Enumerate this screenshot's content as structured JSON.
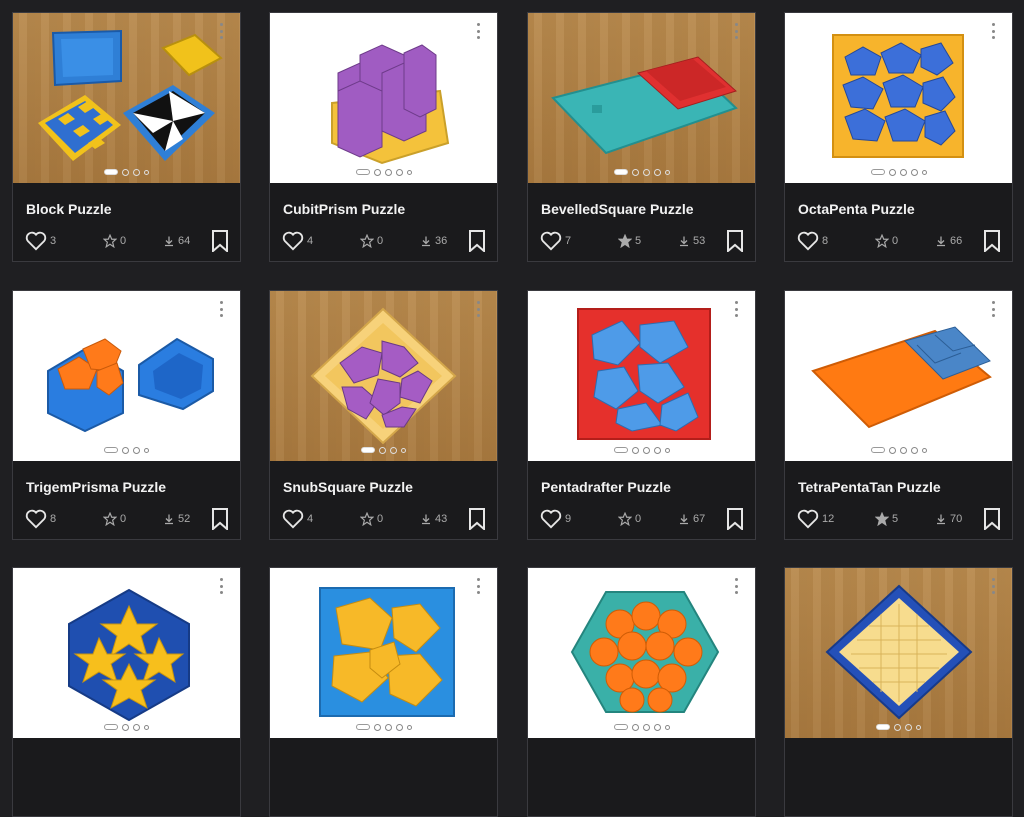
{
  "cards": [
    {
      "title": "Block Puzzle",
      "likes": "3",
      "stars": "0",
      "downloads": "64",
      "starred": false
    },
    {
      "title": "CubitPrism Puzzle",
      "likes": "4",
      "stars": "0",
      "downloads": "36",
      "starred": false
    },
    {
      "title": "BevelledSquare Puzzle",
      "likes": "7",
      "stars": "5",
      "downloads": "53",
      "starred": true
    },
    {
      "title": "OctaPenta Puzzle",
      "likes": "8",
      "stars": "0",
      "downloads": "66",
      "starred": false
    },
    {
      "title": "TrigemPrisma Puzzle",
      "likes": "8",
      "stars": "0",
      "downloads": "52",
      "starred": false
    },
    {
      "title": "SnubSquare Puzzle",
      "likes": "4",
      "stars": "0",
      "downloads": "43",
      "starred": false
    },
    {
      "title": "Pentadrafter Puzzle",
      "likes": "9",
      "stars": "0",
      "downloads": "67",
      "starred": false
    },
    {
      "title": "TetraPentaTan Puzzle",
      "likes": "12",
      "stars": "5",
      "downloads": "70",
      "starred": true
    },
    {
      "title": "",
      "likes": "",
      "stars": "",
      "downloads": "",
      "starred": false
    },
    {
      "title": "",
      "likes": "",
      "stars": "",
      "downloads": "",
      "starred": false
    },
    {
      "title": "",
      "likes": "",
      "stars": "",
      "downloads": "",
      "starred": false
    },
    {
      "title": "",
      "likes": "",
      "stars": "",
      "downloads": "",
      "starred": false
    }
  ],
  "colors": {
    "card_bg": "#1a1a1c",
    "page_bg": "#1f1f22",
    "title": "#f2f2f2",
    "stat": "#aaaaaa"
  },
  "icons": {
    "like": "heart-icon",
    "star": "star-icon",
    "download": "download-icon",
    "bookmark": "bookmark-icon",
    "menu": "kebab-menu-icon"
  }
}
